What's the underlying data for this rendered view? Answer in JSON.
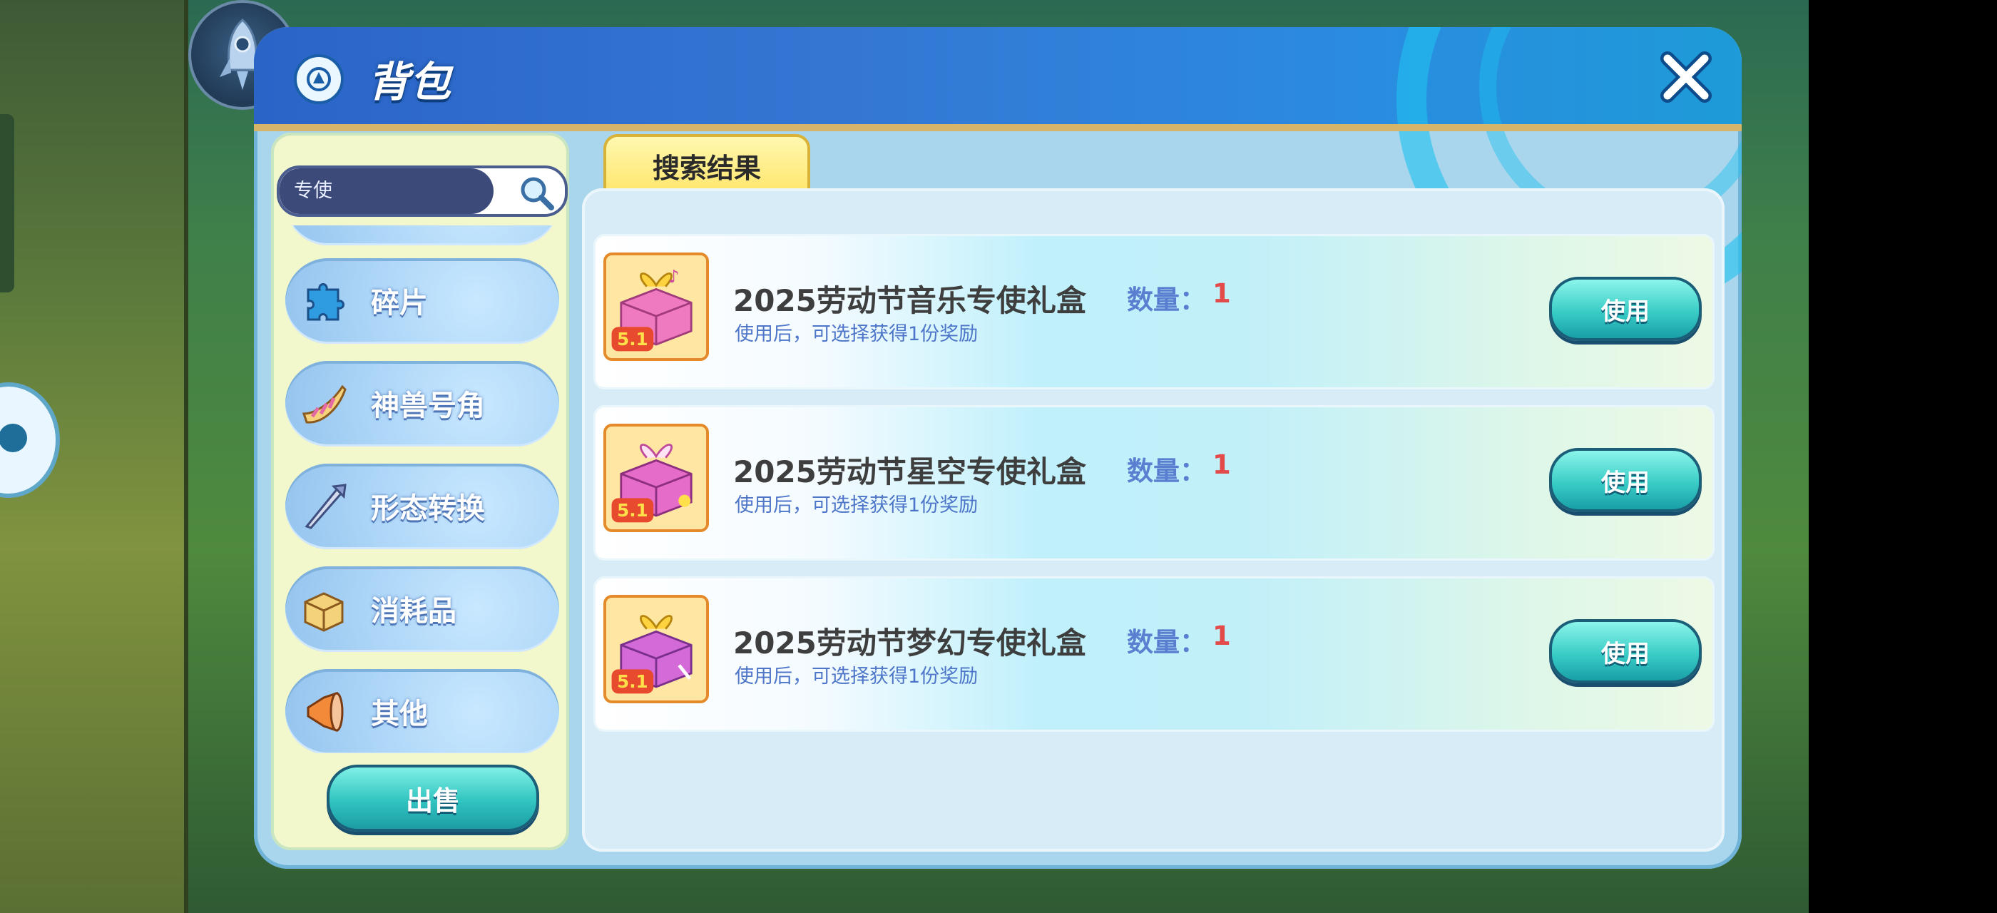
{
  "header": {
    "title": "背包"
  },
  "search": {
    "value": "专使"
  },
  "categories": [
    {
      "label": "碎片",
      "icon": "puzzle-icon"
    },
    {
      "label": "神兽号角",
      "icon": "horn-icon"
    },
    {
      "label": "形态转换",
      "icon": "arrow-icon"
    },
    {
      "label": "消耗品",
      "icon": "box-icon"
    },
    {
      "label": "其他",
      "icon": "megaphone-icon"
    }
  ],
  "sell_button": "出售",
  "tab": {
    "label": "搜索结果"
  },
  "items": [
    {
      "name": "2025劳动节音乐专使礼盒",
      "qty_label": "数量：",
      "qty": "1",
      "desc": "使用后，可选择获得1份奖励",
      "use_label": "使用",
      "badge": "5.1"
    },
    {
      "name": "2025劳动节星空专使礼盒",
      "qty_label": "数量：",
      "qty": "1",
      "desc": "使用后，可选择获得1份奖励",
      "use_label": "使用",
      "badge": "5.1"
    },
    {
      "name": "2025劳动节梦幻专使礼盒",
      "qty_label": "数量：",
      "qty": "1",
      "desc": "使用后，可选择获得1份奖励",
      "use_label": "使用",
      "badge": "5.1"
    }
  ],
  "colors": {
    "accent": "#2b64c7",
    "button": "#39cdc6",
    "qty": "#e34b4b"
  }
}
